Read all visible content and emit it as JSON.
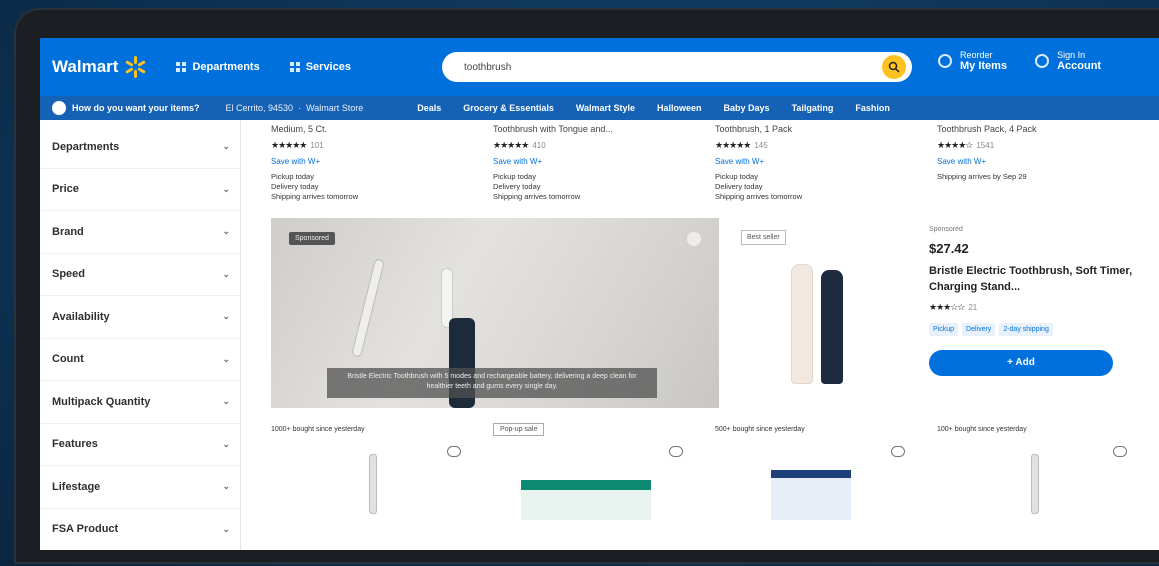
{
  "header": {
    "logo": "Walmart",
    "departments": "Departments",
    "services": "Services",
    "search_value": "toothbrush",
    "reorder_line1": "Reorder",
    "reorder_line2": "My Items",
    "signin_line1": "Sign In",
    "signin_line2": "Account",
    "brand_color": "#0071dc",
    "accent_color": "#ffc220"
  },
  "subbar": {
    "delivery_prompt": "How do you want your items?",
    "location": "El Cerrito, 94530",
    "store": "Walmart Store",
    "links": [
      "Deals",
      "Grocery & Essentials",
      "Walmart Style",
      "Halloween",
      "Baby Days",
      "Tailgating",
      "Fashion"
    ]
  },
  "filters": [
    "Departments",
    "Price",
    "Brand",
    "Speed",
    "Availability",
    "Count",
    "Multipack Quantity",
    "Features",
    "Lifestage",
    "FSA Product"
  ],
  "products_top": [
    {
      "title": "Medium, 5 Ct.",
      "rating_count": "101",
      "save": "Save with W+",
      "fulfillment": [
        "Pickup today",
        "Delivery today",
        "Shipping arrives tomorrow"
      ]
    },
    {
      "title": "Toothbrush with Tongue and...",
      "rating_count": "410",
      "save": "Save with W+",
      "fulfillment": [
        "Pickup today",
        "Delivery today",
        "Shipping arrives tomorrow"
      ]
    },
    {
      "title": "Toothbrush, 1 Pack",
      "rating_count": "145",
      "save": "Save with W+",
      "fulfillment": [
        "Pickup today",
        "Delivery today",
        "Shipping arrives tomorrow"
      ]
    },
    {
      "title": "Toothbrush Pack, 4 Pack",
      "rating_count": "1541",
      "save": "Save with W+",
      "fulfillment": [
        "Shipping arrives by Sep 29"
      ]
    }
  ],
  "featured": {
    "video_badge": "Sponsored",
    "caption": "Bristle Electric Toothbrush with 5 modes and rechargeable battery, delivering a deep clean for healthier teeth and gums every single day.",
    "best_seller": "Best seller",
    "sponsored": "Sponsored",
    "price": "$27.42",
    "name": "Bristle Electric Toothbrush, Soft Timer, Charging Stand...",
    "rating_count": "21",
    "tags": [
      "Pickup",
      "Delivery",
      "2-day shipping"
    ],
    "add_label": "+ Add"
  },
  "row3": [
    "1000+ bought since yesterday",
    "Pop-up sale",
    "500+ bought since yesterday",
    "100+ bought since yesterday"
  ]
}
